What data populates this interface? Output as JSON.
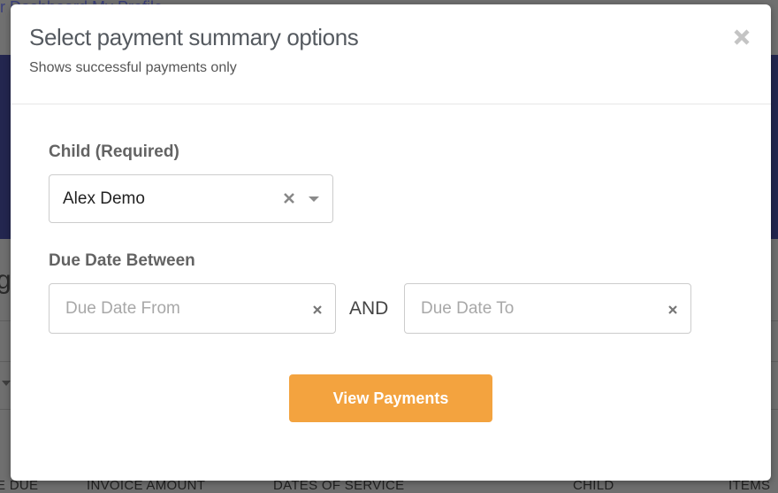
{
  "background": {
    "nav_fragment": "r         Dashboard    My Profile",
    "heading_fragment": "g",
    "table_headers": [
      "E DUE",
      "INVOICE AMOUNT",
      "DATES OF SERVICE",
      "CHILD",
      "ITEMS"
    ]
  },
  "modal": {
    "title": "Select payment summary options",
    "subtitle": "Shows successful payments only",
    "close_icon": "close-icon",
    "child_field": {
      "label": "Child (Required)",
      "value": "Alex Demo",
      "clear_icon": "clear-icon",
      "dropdown_icon": "chevron-down-icon"
    },
    "due_date": {
      "label": "Due Date Between",
      "from_placeholder": "Due Date From",
      "from_value": "",
      "connector": "AND",
      "to_placeholder": "Due Date To",
      "to_value": ""
    },
    "submit_label": "View Payments"
  },
  "colors": {
    "accent_button": "#f3a33f",
    "header_band": "#23264f",
    "title_text": "#555a60"
  }
}
